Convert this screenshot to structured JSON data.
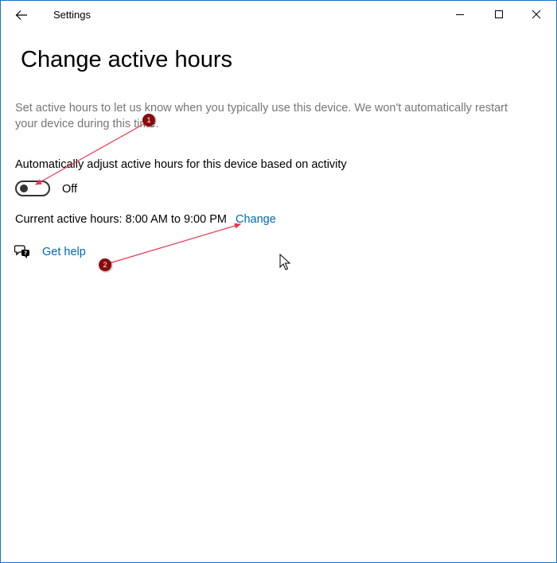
{
  "window": {
    "title": "Settings"
  },
  "page": {
    "title": "Change active hours",
    "description": "Set active hours to let us know when you typically use this device. We won't automatically restart your device during this time.",
    "toggle": {
      "label": "Automatically adjust active hours for this device based on activity",
      "state": "Off"
    },
    "current_hours": "Current active hours: 8:00 AM to 9:00 PM",
    "change_link": "Change",
    "help_link": "Get help"
  },
  "annotations": {
    "badge_1": "1",
    "badge_2": "2"
  },
  "colors": {
    "accent_link": "#0067b8",
    "window_border": "#1a73c7",
    "description_text": "#767676",
    "annotation_badge": "#8b0a0a",
    "annotation_arrow": "#e8384f"
  },
  "icons": {
    "back": "arrow-left-icon",
    "minimize": "minimize-icon",
    "maximize": "maximize-icon",
    "close": "close-icon",
    "help": "help-chat-icon",
    "cursor": "mouse-pointer-icon"
  }
}
